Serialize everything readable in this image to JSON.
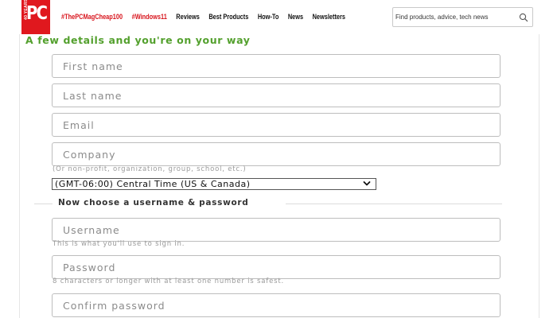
{
  "header": {
    "logo_text": "PC",
    "logo_years": "40 YEARS",
    "nav": [
      {
        "label": "#ThePCMagCheap100",
        "color": "#d8141c"
      },
      {
        "label": "#Windows11",
        "color": "#d8141c"
      },
      {
        "label": "Reviews",
        "color": "#111111"
      },
      {
        "label": "Best Products",
        "color": "#111111"
      },
      {
        "label": "How-To",
        "color": "#111111"
      },
      {
        "label": "News",
        "color": "#111111"
      },
      {
        "label": "Newsletters",
        "color": "#111111"
      }
    ],
    "search": {
      "placeholder": "Find products, advice, tech news",
      "icon": "search-icon"
    }
  },
  "form": {
    "heading": "A few details and you're on your way",
    "first_name": {
      "placeholder": "First name",
      "value": ""
    },
    "last_name": {
      "placeholder": "Last name",
      "value": ""
    },
    "email": {
      "placeholder": "Email",
      "value": ""
    },
    "company": {
      "placeholder": "Company",
      "value": ""
    },
    "company_hint": "(Or non-profit, organization, group, school, etc.)",
    "timezone": {
      "selected": "(GMT-06:00) Central Time (US & Canada)",
      "icon": "chevron-down-icon"
    },
    "credentials_section_title": "Now choose a username & password",
    "username": {
      "placeholder": "Username",
      "value": ""
    },
    "username_hint": "This is what you'll use to sign in.",
    "password": {
      "placeholder": "Password",
      "value": ""
    },
    "password_hint": "8 characters or longer with at least one number is safest.",
    "confirm_password": {
      "placeholder": "Confirm password",
      "value": ""
    }
  },
  "colors": {
    "brand_red": "#e0181e",
    "heading_green": "#53a02d"
  }
}
